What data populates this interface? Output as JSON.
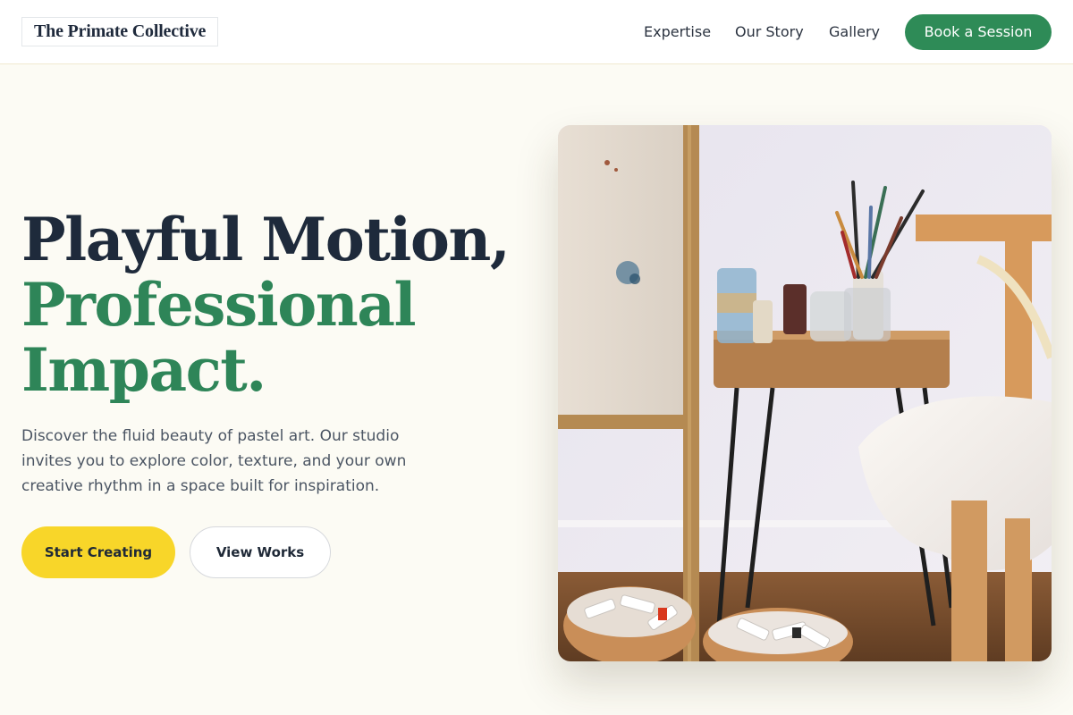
{
  "header": {
    "logo_text": "The Primate Collective",
    "nav": [
      {
        "label": "Expertise"
      },
      {
        "label": "Our Story"
      },
      {
        "label": "Gallery"
      }
    ],
    "cta_label": "Book a Session"
  },
  "hero": {
    "headline_line1": "Playful Motion,",
    "headline_line2": "Professional",
    "headline_line3": "Impact.",
    "description": "Discover the fluid beauty of pastel art. Our studio invites you to explore color, texture, and your own creative rhythm in a space built for inspiration.",
    "primary_button": "Start Creating",
    "secondary_button": "View Works",
    "image": {
      "subject": "art-studio-photo"
    }
  },
  "colors": {
    "page_background": "#fcfbf4",
    "brand_green": "#2e8b57",
    "headline_dark": "#1e2a3b",
    "accent_yellow": "#f8d629"
  }
}
